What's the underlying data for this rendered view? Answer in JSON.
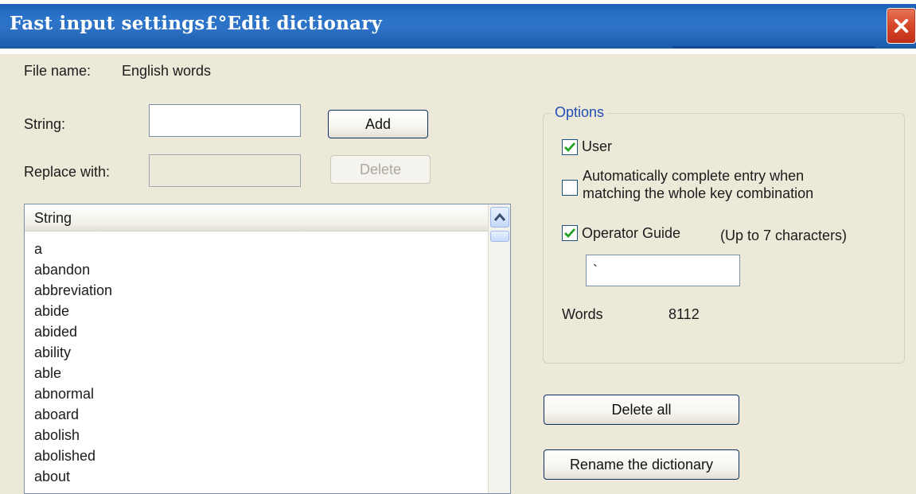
{
  "window": {
    "title": "Fast input settings£°Edit dictionary"
  },
  "file": {
    "label": "File name:",
    "value": "English words"
  },
  "string": {
    "label": "String:",
    "value": ""
  },
  "replace": {
    "label": "Replace with:",
    "value": ""
  },
  "buttons": {
    "add": "Add",
    "delete": "Delete",
    "delete_all": "Delete all",
    "rename": "Rename the dictionary"
  },
  "list": {
    "header": "String",
    "items": [
      "a",
      "abandon",
      "abbreviation",
      "abide",
      "abided",
      "ability",
      "able",
      "abnormal",
      "aboard",
      "abolish",
      "abolished",
      "about"
    ]
  },
  "options": {
    "title": "Options",
    "user": {
      "label": "User",
      "checked": true
    },
    "auto_complete": {
      "label_line1": "Automatically complete entry when",
      "label_line2": "matching the whole key combination",
      "checked": false
    },
    "operator_guide": {
      "label": "Operator Guide",
      "checked": true,
      "hint": "(Up to 7 characters)",
      "value": "`"
    },
    "words": {
      "label": "Words",
      "value": "8112"
    }
  },
  "icons": {
    "close": "close-icon",
    "checkmark": "checkmark-icon",
    "scroll_up": "chevron-up-icon"
  },
  "colors": {
    "title_bar": "#2d72c7",
    "close_button": "#d94a2c",
    "dialog_background": "#ece9d8",
    "group_title": "#1f4fb5",
    "checkmark": "#21a121"
  }
}
